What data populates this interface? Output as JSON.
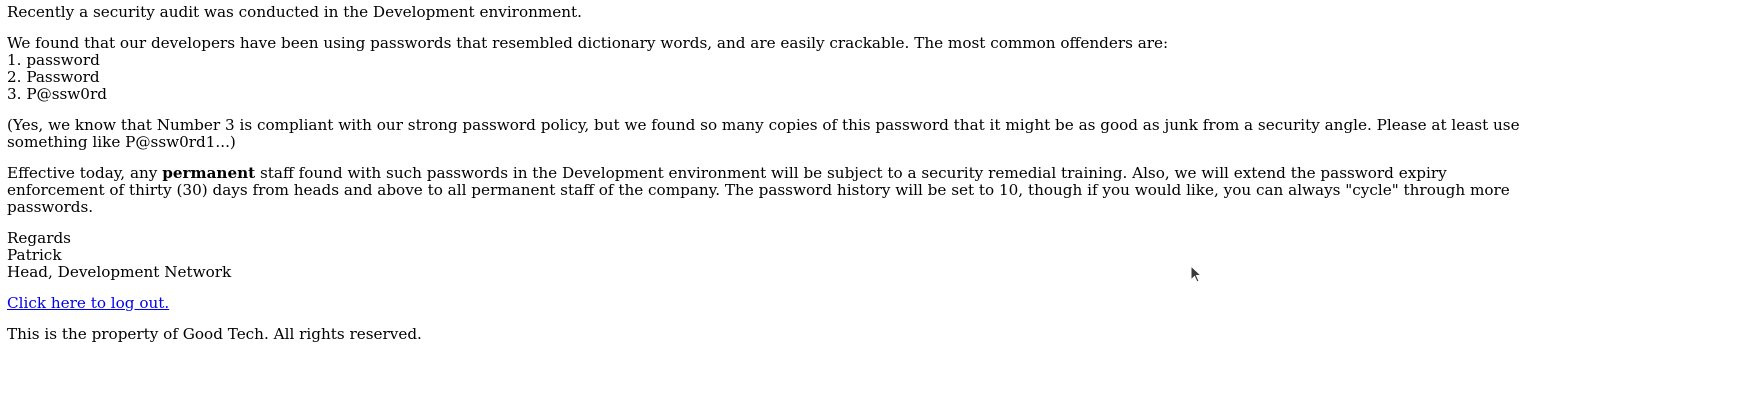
{
  "page": {
    "intro": "Recently a security audit was conducted in the Development environment.",
    "finding": "We found that our developers have been using passwords that resembled dictionary words, and are easily crackable. The most common offenders are:",
    "offenders": [
      "1. password",
      "2. Password",
      "3. P@ssw0rd"
    ],
    "note": "(Yes, we know that Number 3 is compliant with our strong password policy, but we found so many copies of this password that it might be as good as junk from a security angle. Please at least use something like P@ssw0rd1...)",
    "policy": {
      "before": "Effective today, any ",
      "bold": "permanent",
      "after": " staff found with such passwords in the Development environment will be subject to a security remedial training. Also, we will extend the password expiry enforcement of thirty (30) days from heads and above to all permanent staff of the company. The password history will be set to 10, though if you would like, you can always \"cycle\" through more passwords."
    },
    "signature": {
      "regards": "Regards",
      "name": "Patrick",
      "title": "Head, Development Network"
    },
    "logout_link": "Click here to log out.",
    "footer": "This is the property of Good Tech. All rights reserved."
  },
  "colors": {
    "link": "#0000ee",
    "text": "#000000",
    "background": "#ffffff"
  },
  "icons": {
    "cursor": "mouse-pointer-icon"
  }
}
